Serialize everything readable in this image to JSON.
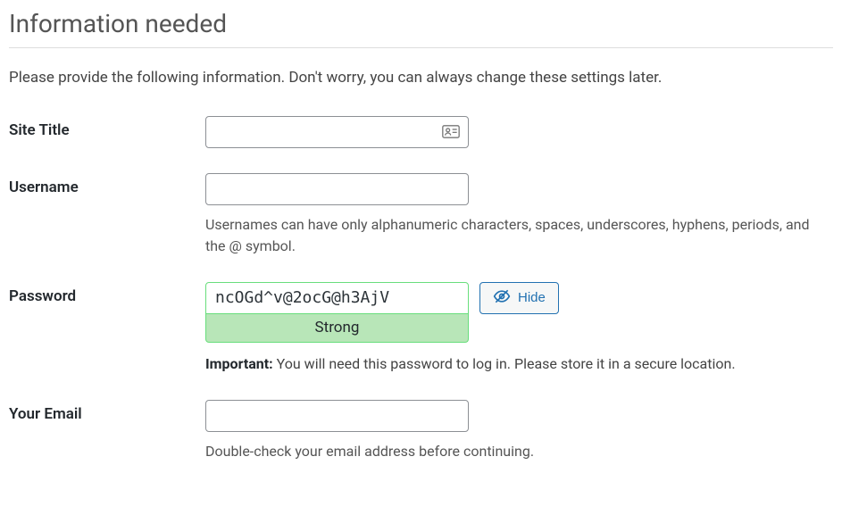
{
  "heading": "Information needed",
  "intro": "Please provide the following information. Don't worry, you can always change these settings later.",
  "fields": {
    "site_title": {
      "label": "Site Title",
      "value": ""
    },
    "username": {
      "label": "Username",
      "value": "",
      "description": "Usernames can have only alphanumeric characters, spaces, underscores, hyphens, periods, and the @ symbol."
    },
    "password": {
      "label": "Password",
      "value": "ncOGd^v@2ocG@h3AjV",
      "strength": "Strong",
      "hide_button": "Hide",
      "important_label": "Important:",
      "important_text": " You will need this password to log in. Please store it in a secure location."
    },
    "email": {
      "label": "Your Email",
      "value": "",
      "description": "Double-check your email address before continuing."
    }
  }
}
